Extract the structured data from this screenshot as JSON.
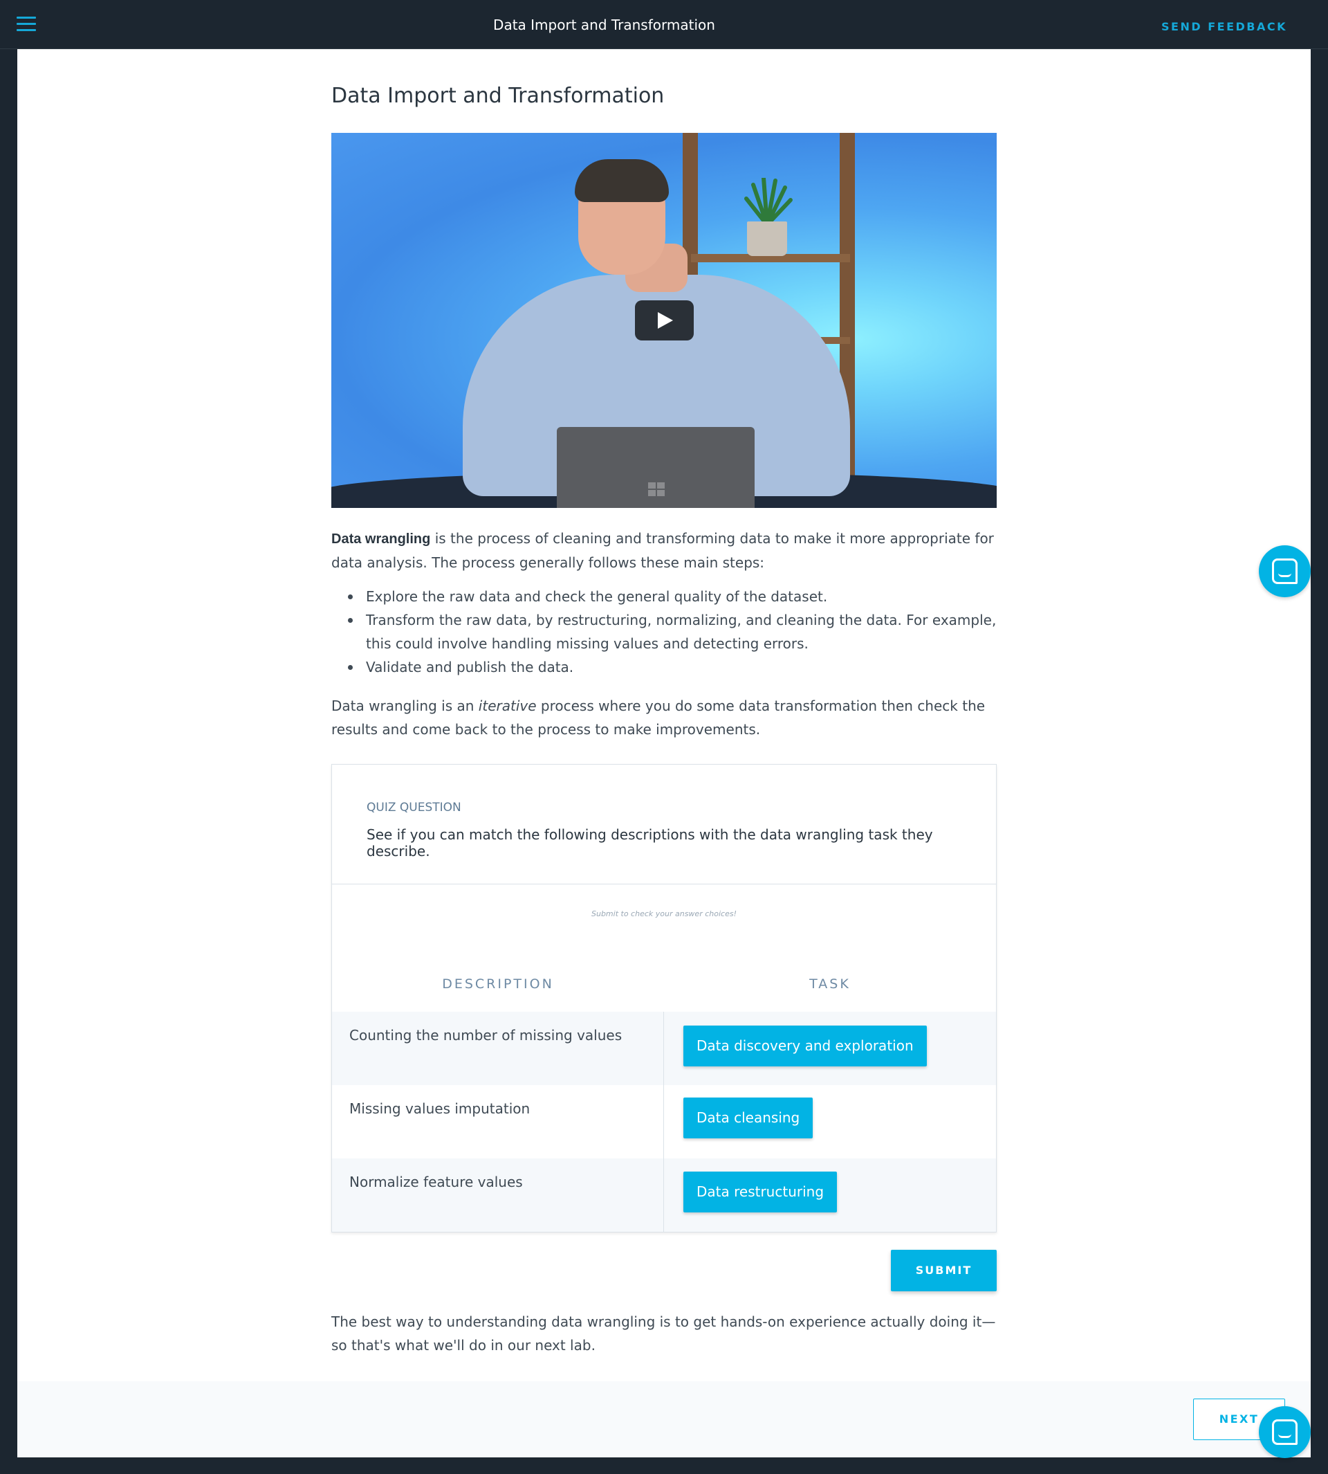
{
  "topbar": {
    "title": "Data Import and Transformation",
    "feedback_label": "SEND FEEDBACK",
    "menu_icon": "hamburger-menu-icon"
  },
  "main": {
    "title": "Data Import and Transformation",
    "video": {
      "play_icon": "play-icon"
    },
    "intro_bold": "Data wrangling",
    "intro_rest": " is the process of cleaning and transforming data to make it more appropriate for data analysis. The process generally follows these main steps:",
    "steps": [
      "Explore the raw data and check the general quality of the dataset.",
      "Transform the raw data, by restructuring, normalizing, and cleaning the data. For example, this could involve handling missing values and detecting errors.",
      "Validate and publish the data."
    ],
    "iterative_pre": "Data wrangling is an ",
    "iterative_em": "iterative",
    "iterative_post": " process where you do some data transformation then check the results and come back to the process to make improvements.",
    "closing": "The best way to understanding data wrangling is to get hands-on experience actually doing it—so that's what we'll do in our next lab."
  },
  "quiz": {
    "label": "QUIZ QUESTION",
    "question": "See if you can match the following descriptions with the data wrangling task they describe.",
    "hint": "Submit to check your answer choices!",
    "col_description": "DESCRIPTION",
    "col_task": "TASK",
    "rows": [
      {
        "description": "Counting the number of missing values",
        "task": "Data discovery and exploration"
      },
      {
        "description": "Missing values imputation",
        "task": "Data cleansing"
      },
      {
        "description": "Normalize feature values",
        "task": "Data restructuring"
      }
    ],
    "submit_label": "SUBMIT"
  },
  "footer": {
    "next_label": "NEXT"
  },
  "chat": {
    "icon": "chat-icon"
  },
  "colors": {
    "accent": "#02b3e4",
    "topbar": "#1c2630",
    "feedback": "#15a8d8"
  }
}
